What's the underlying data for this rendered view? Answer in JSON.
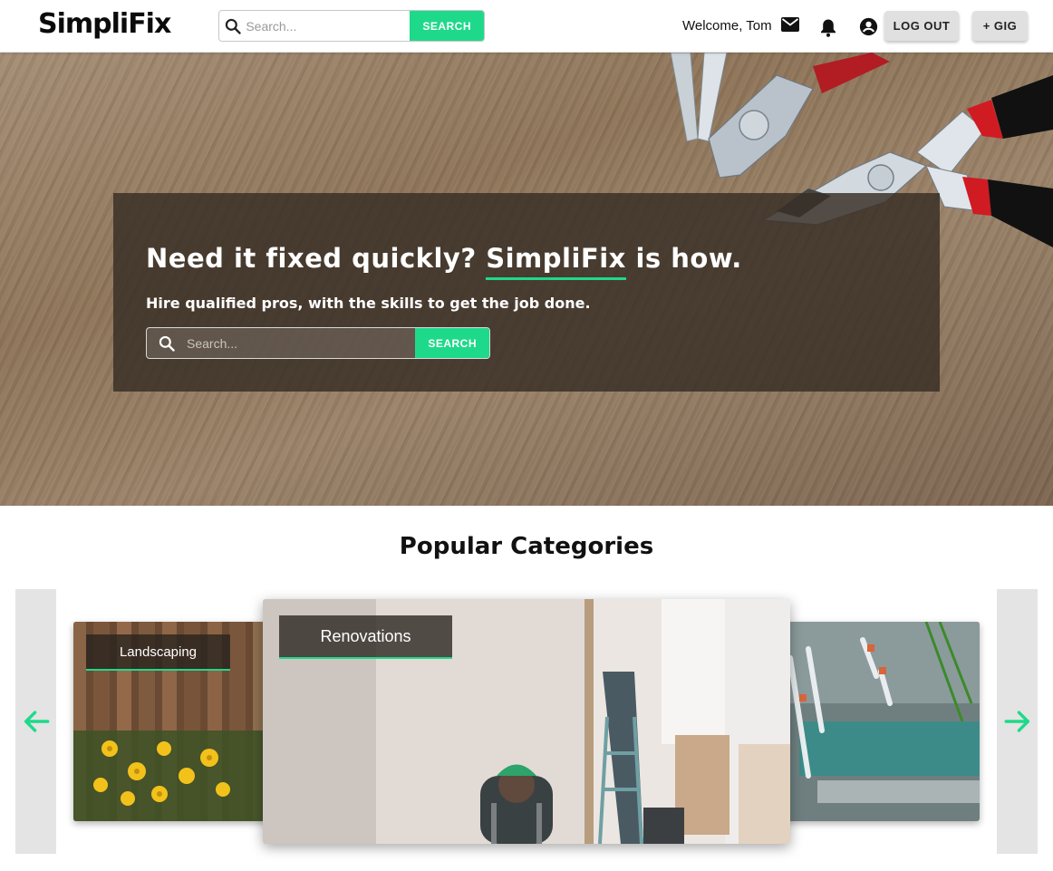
{
  "header": {
    "logo": "SimpliFix",
    "search_placeholder": "Search...",
    "search_button": "SEARCH",
    "welcome": "Welcome, Tom",
    "logout_label": "LOG OUT",
    "gig_label": "+ GIG",
    "icons": [
      "search-icon",
      "mail-icon",
      "bell-icon",
      "account-circle-icon"
    ]
  },
  "hero": {
    "title_before": "Need it fixed quickly? ",
    "title_brand": "SimpliFix",
    "title_after": " is how.",
    "subtitle": "Hire qualified pros, with the skills to get the job done.",
    "search_placeholder": "Search...",
    "search_button": "SEARCH"
  },
  "categories": {
    "title": "Popular Categories",
    "cards": [
      {
        "label": "Landscaping"
      },
      {
        "label": "Renovations"
      },
      {
        "label": ""
      }
    ],
    "prev_icon": "arrow-left-icon",
    "next_icon": "arrow-right-icon"
  },
  "colors": {
    "accent": "#1fd98a",
    "button_gray": "#e0e0e0",
    "overlay": "#372d24"
  }
}
